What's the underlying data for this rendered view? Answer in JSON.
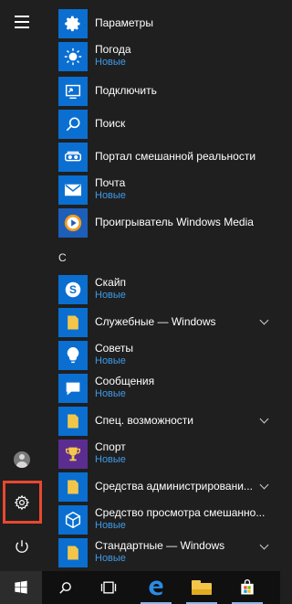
{
  "colors": {
    "background": "#1f1f1f",
    "tile": "#0a6fd1",
    "subtext": "#3d9be8",
    "highlight": "#e8482f",
    "taskbar": "#101010"
  },
  "start_menu": {
    "section_letter": "С",
    "items": [
      {
        "name": "Параметры",
        "sub": "",
        "icon": "gear-icon",
        "tile": "blue"
      },
      {
        "name": "Погода",
        "sub": "Новые",
        "icon": "sun-icon",
        "tile": "blue"
      },
      {
        "name": "Подключить",
        "sub": "",
        "icon": "cast-icon",
        "tile": "blue"
      },
      {
        "name": "Поиск",
        "sub": "",
        "icon": "search-icon",
        "tile": "blue"
      },
      {
        "name": "Портал смешанной реальности",
        "sub": "",
        "icon": "headset-icon",
        "tile": "blue"
      },
      {
        "name": "Почта",
        "sub": "Новые",
        "icon": "mail-icon",
        "tile": "blue"
      },
      {
        "name": "Проигрыватель Windows Media",
        "sub": "",
        "icon": "media-player-icon",
        "tile": "blue"
      },
      {
        "name": "Скайп",
        "sub": "Новые",
        "icon": "skype-icon",
        "tile": "blue"
      },
      {
        "name": "Служебные — Windows",
        "sub": "",
        "icon": "folder-icon",
        "tile": "folder",
        "expand": true
      },
      {
        "name": "Советы",
        "sub": "Новые",
        "icon": "lightbulb-icon",
        "tile": "blue"
      },
      {
        "name": "Сообщения",
        "sub": "Новые",
        "icon": "message-icon",
        "tile": "blue"
      },
      {
        "name": "Спец. возможности",
        "sub": "",
        "icon": "folder-icon",
        "tile": "folder",
        "expand": true
      },
      {
        "name": "Спорт",
        "sub": "Новые",
        "icon": "trophy-icon",
        "tile": "sports"
      },
      {
        "name": "Средства администрировани...",
        "sub": "",
        "icon": "folder-icon",
        "tile": "folder",
        "expand": true
      },
      {
        "name": "Средство просмотра смешанно...",
        "sub": "Новые",
        "icon": "cube-icon",
        "tile": "blue"
      },
      {
        "name": "Стандартные — Windows",
        "sub": "Новые",
        "icon": "folder-icon",
        "tile": "folder",
        "expand": true
      }
    ]
  },
  "rail": {
    "menu_icon": "hamburger-icon",
    "user_icon": "user-avatar-icon",
    "settings_icon": "gear-icon",
    "power_icon": "power-icon"
  },
  "taskbar": {
    "items": [
      "windows-logo-icon",
      "search-icon",
      "task-view-icon",
      "edge-icon",
      "file-explorer-icon",
      "store-icon"
    ]
  }
}
